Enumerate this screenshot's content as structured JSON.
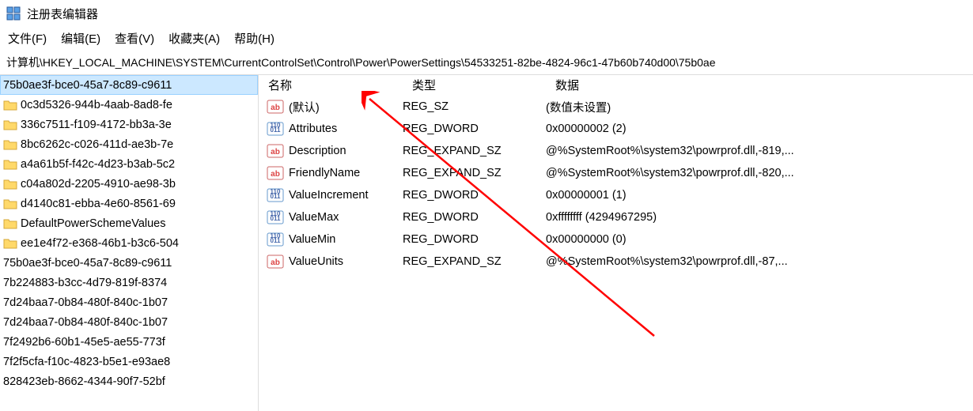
{
  "window": {
    "title": "注册表编辑器"
  },
  "menu": {
    "file": "文件(F)",
    "edit": "编辑(E)",
    "view": "查看(V)",
    "favorites": "收藏夹(A)",
    "help": "帮助(H)"
  },
  "address": "计算机\\HKEY_LOCAL_MACHINE\\SYSTEM\\CurrentControlSet\\Control\\Power\\PowerSettings\\54533251-82be-4824-96c1-47b60b740d00\\75b0ae",
  "tree": {
    "items": [
      {
        "label": "75b0ae3f-bce0-45a7-8c89-c9611",
        "folder": false,
        "sel": true
      },
      {
        "label": "0c3d5326-944b-4aab-8ad8-fe",
        "folder": true
      },
      {
        "label": "336c7511-f109-4172-bb3a-3e",
        "folder": true
      },
      {
        "label": "8bc6262c-c026-411d-ae3b-7e",
        "folder": true
      },
      {
        "label": "a4a61b5f-f42c-4d23-b3ab-5c2",
        "folder": true
      },
      {
        "label": "c04a802d-2205-4910-ae98-3b",
        "folder": true
      },
      {
        "label": "d4140c81-ebba-4e60-8561-69",
        "folder": true
      },
      {
        "label": "DefaultPowerSchemeValues",
        "folder": true
      },
      {
        "label": "ee1e4f72-e368-46b1-b3c6-504",
        "folder": true
      },
      {
        "label": "75b0ae3f-bce0-45a7-8c89-c9611",
        "folder": false
      },
      {
        "label": "7b224883-b3cc-4d79-819f-8374",
        "folder": false
      },
      {
        "label": "7d24baa7-0b84-480f-840c-1b07",
        "folder": false
      },
      {
        "label": "7d24baa7-0b84-480f-840c-1b07",
        "folder": false
      },
      {
        "label": "7f2492b6-60b1-45e5-ae55-773f",
        "folder": false
      },
      {
        "label": "7f2f5cfa-f10c-4823-b5e1-e93ae8",
        "folder": false
      },
      {
        "label": "828423eb-8662-4344-90f7-52bf",
        "folder": false
      }
    ]
  },
  "columns": {
    "name": "名称",
    "type": "类型",
    "data": "数据"
  },
  "rows": [
    {
      "icon": "sz",
      "name": "(默认)",
      "type": "REG_SZ",
      "data": "(数值未设置)",
      "sel": false
    },
    {
      "icon": "bin",
      "name": "Attributes",
      "type": "REG_DWORD",
      "data": "0x00000002 (2)",
      "sel": true
    },
    {
      "icon": "sz",
      "name": "Description",
      "type": "REG_EXPAND_SZ",
      "data": "@%SystemRoot%\\system32\\powrprof.dll,-819,...",
      "sel": false
    },
    {
      "icon": "sz",
      "name": "FriendlyName",
      "type": "REG_EXPAND_SZ",
      "data": "@%SystemRoot%\\system32\\powrprof.dll,-820,...",
      "sel": false
    },
    {
      "icon": "bin",
      "name": "ValueIncrement",
      "type": "REG_DWORD",
      "data": "0x00000001 (1)",
      "sel": false
    },
    {
      "icon": "bin",
      "name": "ValueMax",
      "type": "REG_DWORD",
      "data": "0xffffffff (4294967295)",
      "sel": false
    },
    {
      "icon": "bin",
      "name": "ValueMin",
      "type": "REG_DWORD",
      "data": "0x00000000 (0)",
      "sel": false
    },
    {
      "icon": "sz",
      "name": "ValueUnits",
      "type": "REG_EXPAND_SZ",
      "data": "@%SystemRoot%\\system32\\powrprof.dll,-87,...",
      "sel": false
    }
  ]
}
